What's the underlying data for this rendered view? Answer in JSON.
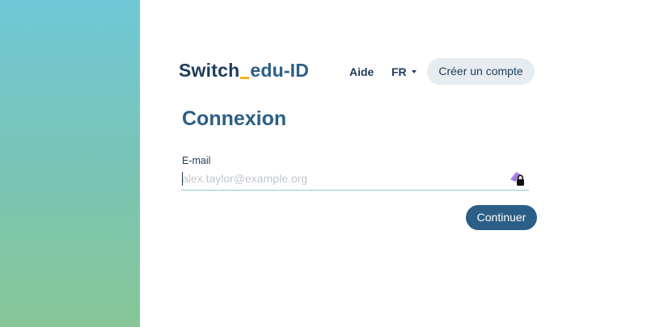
{
  "brand": {
    "part1": "Switch",
    "part2": "edu-ID"
  },
  "header": {
    "help_label": "Aide",
    "language_label": "FR",
    "create_account_label": "Créer un compte"
  },
  "login": {
    "title": "Connexion",
    "email_label": "E-mail",
    "email_placeholder": "alex.taylor@example.org",
    "email_value": "",
    "continue_label": "Continuer"
  },
  "icons": {
    "password_manager": "password-manager-lock-icon",
    "language_caret": "chevron-down-icon"
  },
  "colors": {
    "primary": "#2b5f87",
    "brand_dark": "#1f3b5a",
    "brand_accent": "#f2b01e",
    "secondary_button_bg": "#e6ecf0",
    "side_gradient_top": "#6fc8d6",
    "side_gradient_bottom": "#86c696"
  }
}
